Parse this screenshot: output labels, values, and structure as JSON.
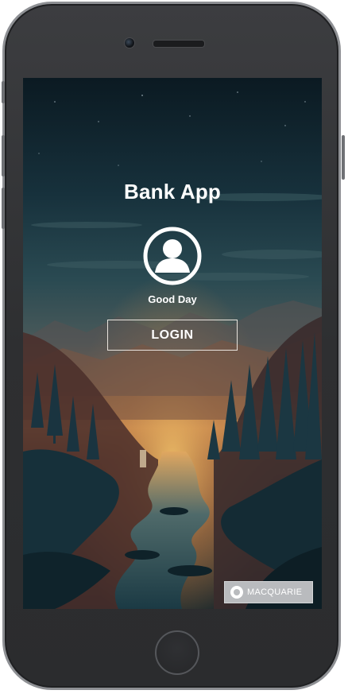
{
  "app": {
    "title": "Bank App",
    "greeting": "Good Day",
    "login_label": "LOGIN"
  },
  "branding": {
    "name": "MACQUARIE",
    "logo_icon": "macquarie-logo-icon"
  },
  "icons": {
    "avatar": "user-avatar-icon"
  },
  "colors": {
    "text": "#ffffff",
    "button_border": "#e9e4de",
    "brand_bg": "#b9bbbe",
    "device_frame": "#2e2f31"
  }
}
